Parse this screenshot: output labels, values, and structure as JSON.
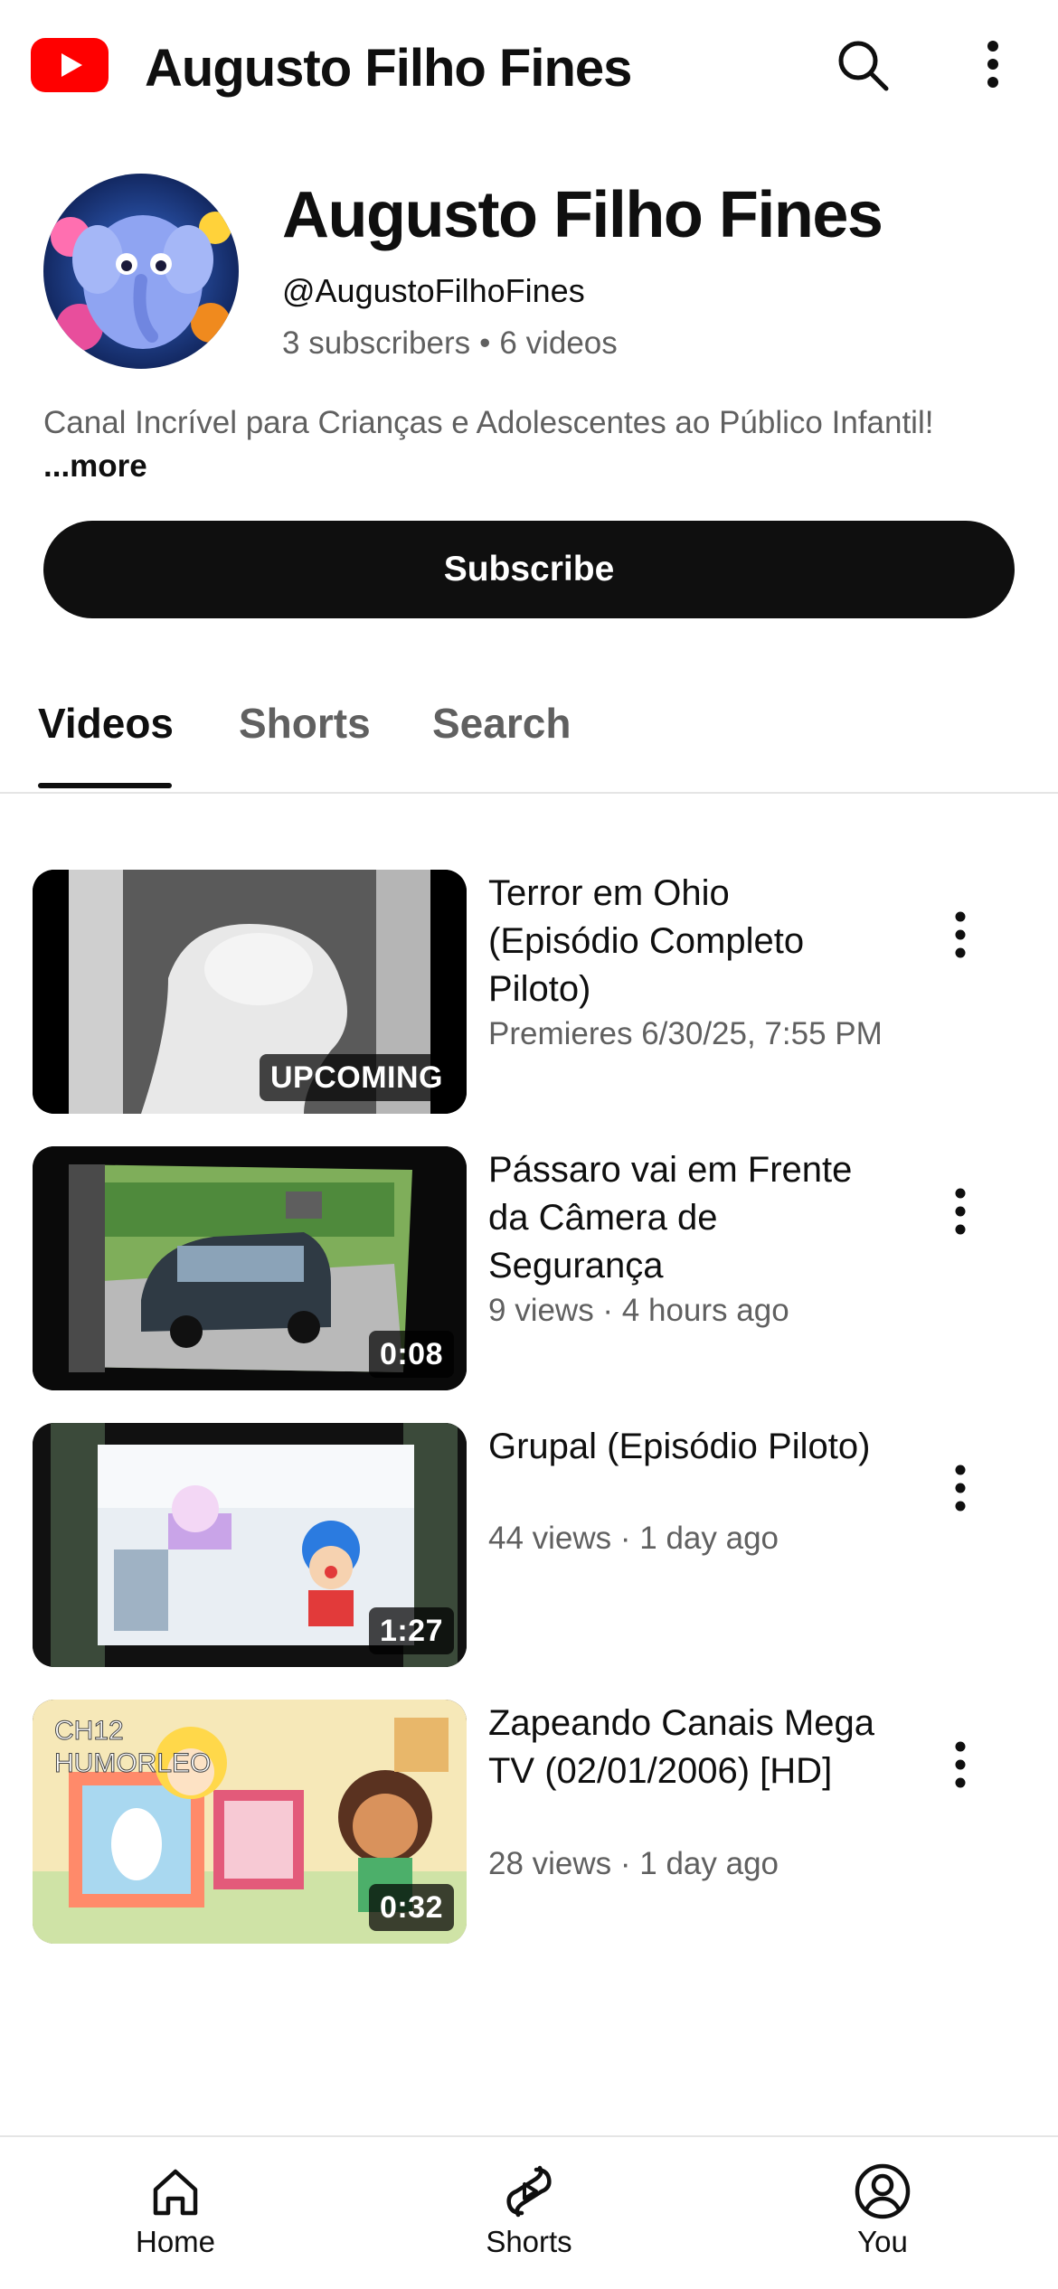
{
  "header": {
    "title": "Augusto Filho Fines",
    "logo_icon": "youtube-logo-icon",
    "search_icon": "search-icon",
    "more_icon": "more-vert-icon",
    "brand_color": "#ff0000"
  },
  "channel": {
    "name": "Augusto Filho Fines",
    "handle": "@AugustoFilhoFines",
    "subscribers": "3 subscribers",
    "separator": "•",
    "videos_count": "6 videos",
    "description": "Canal Incrível para Crianças e Adolescentes ao Público Infantil!",
    "more_label": "...more",
    "subscribe_label": "Subscribe"
  },
  "tabs": [
    {
      "label": "Videos",
      "active": true
    },
    {
      "label": "Shorts",
      "active": false
    },
    {
      "label": "Search",
      "active": false
    }
  ],
  "videos": [
    {
      "title": "Terror em Ohio (Episódio Completo Piloto)",
      "meta": "Premieres 6/30/25, 7:55 PM",
      "badge": "UPCOMING"
    },
    {
      "title": "Pássaro vai em Frente da Câmera de Segurança",
      "meta": "9 views · 4 hours ago",
      "badge": "0:08"
    },
    {
      "title": "Grupal (Episódio Piloto)",
      "meta": "44 views · 1 day ago",
      "badge": "1:27"
    },
    {
      "title": "Zapeando Canais Mega TV (02/01/2006) [HD]",
      "meta": "28 views · 1 day ago",
      "badge": "0:32",
      "thumb_text": "CH12 HUMORLEO"
    }
  ],
  "bottom_nav": [
    {
      "label": "Home",
      "icon": "home-icon"
    },
    {
      "label": "Shorts",
      "icon": "shorts-icon"
    },
    {
      "label": "You",
      "icon": "you-account-icon"
    }
  ]
}
